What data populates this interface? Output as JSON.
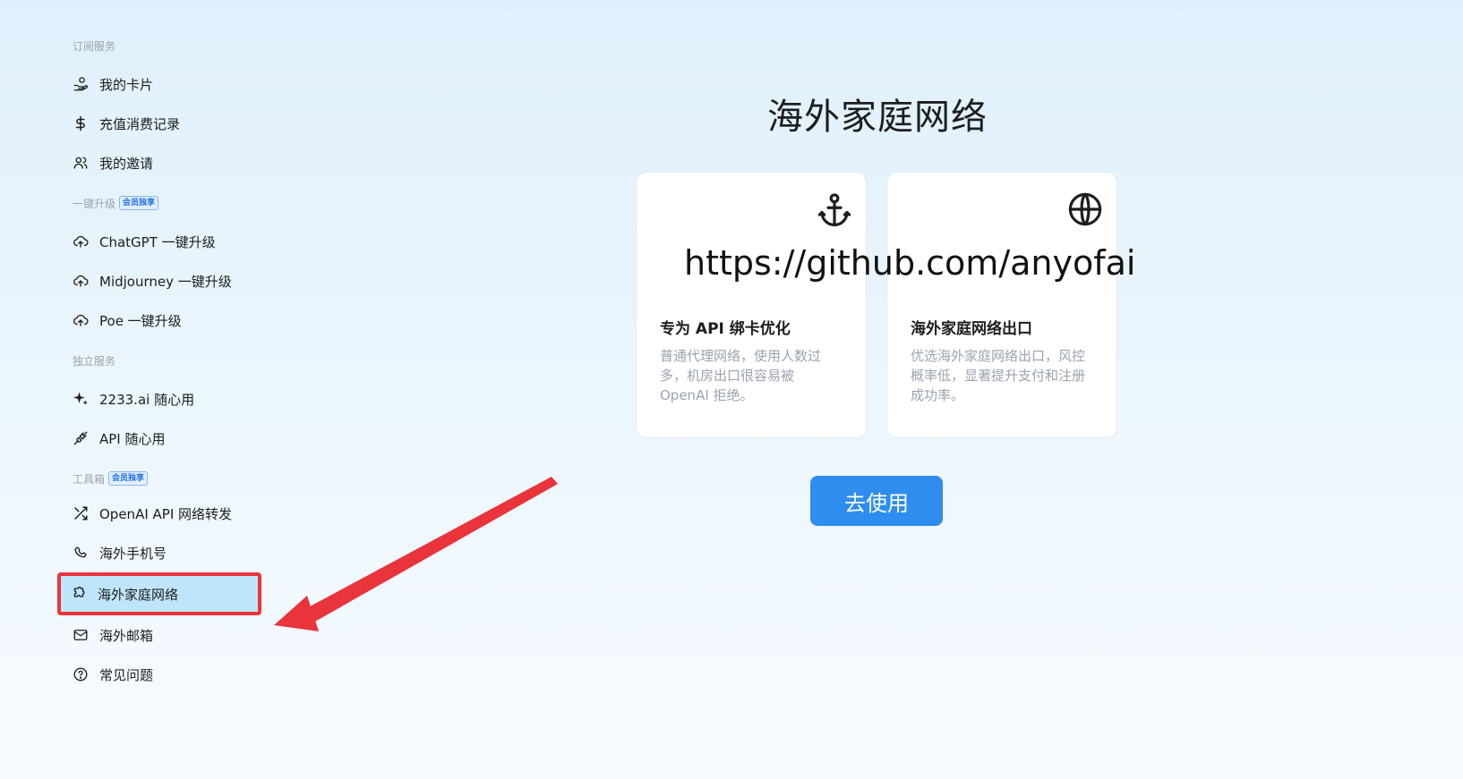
{
  "sidebar": {
    "sections": [
      {
        "title": "订阅服务",
        "badge": "",
        "items": [
          {
            "label": "我的卡片",
            "icon": "hand-coin-icon"
          },
          {
            "label": "充值消费记录",
            "icon": "dollar-icon"
          },
          {
            "label": "我的邀请",
            "icon": "users-icon"
          }
        ]
      },
      {
        "title": "一键升级",
        "badge": "会员独享",
        "items": [
          {
            "label": "ChatGPT 一键升级",
            "icon": "cloud-upload-icon"
          },
          {
            "label": "Midjourney 一键升级",
            "icon": "cloud-upload-icon"
          },
          {
            "label": "Poe 一键升级",
            "icon": "cloud-upload-icon"
          }
        ]
      },
      {
        "title": "独立服务",
        "badge": "",
        "items": [
          {
            "label": "2233.ai 随心用",
            "icon": "sparkle-icon"
          },
          {
            "label": "API 随心用",
            "icon": "plug-icon"
          }
        ]
      },
      {
        "title": "工具箱",
        "badge": "会员独享",
        "items": [
          {
            "label": "OpenAI API 网络转发",
            "icon": "shuffle-icon"
          },
          {
            "label": "海外手机号",
            "icon": "phone-icon"
          },
          {
            "label": "海外家庭网络",
            "icon": "puzzle-icon",
            "active": true
          },
          {
            "label": "海外邮箱",
            "icon": "mail-icon"
          },
          {
            "label": "常见问题",
            "icon": "help-circle-icon"
          }
        ]
      }
    ]
  },
  "main": {
    "title": "海外家庭网络",
    "url_overlay": "https://github.com/anyofai",
    "cards": [
      {
        "icon": "anchor-icon",
        "title": "专为 API 绑卡优化",
        "desc": "普通代理网络，使用人数过多，机房出口很容易被 OpenAI 拒绝。"
      },
      {
        "icon": "globe-icon",
        "title": "海外家庭网络出口",
        "desc": "优选海外家庭网络出口，风控概率低，显著提升支付和注册成功率。"
      }
    ],
    "button_label": "去使用"
  },
  "colors": {
    "accent": "#2e8def",
    "highlight": "#e8343a",
    "active_bg": "#bfe5fb"
  }
}
